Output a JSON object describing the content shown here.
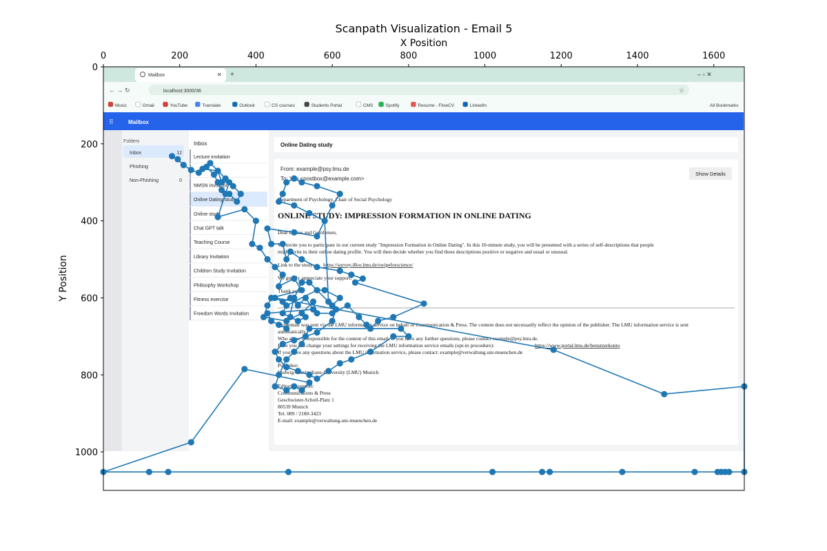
{
  "chart_data": {
    "type": "scatter",
    "title": "Scanpath Visualization - Email 5",
    "xlabel": "X Position",
    "ylabel": "Y Position",
    "xlim": [
      0,
      1680
    ],
    "ylim": [
      1100,
      0
    ],
    "x_axis_position": "top",
    "y_inverted": true,
    "x_ticks": [
      0,
      200,
      400,
      600,
      800,
      1000,
      1200,
      1400,
      1600
    ],
    "y_ticks": [
      0,
      200,
      400,
      600,
      800,
      1000
    ],
    "grid": false,
    "series_color": "#1f77b4",
    "points": [
      [
        180,
        232
      ],
      [
        195,
        240
      ],
      [
        210,
        255
      ],
      [
        230,
        268
      ],
      [
        250,
        275
      ],
      [
        270,
        260
      ],
      [
        290,
        280
      ],
      [
        300,
        300
      ],
      [
        310,
        320
      ],
      [
        330,
        330
      ],
      [
        350,
        350
      ],
      [
        360,
        330
      ],
      [
        340,
        310
      ],
      [
        320,
        290
      ],
      [
        280,
        250
      ],
      [
        260,
        265
      ],
      [
        300,
        270
      ],
      [
        310,
        300
      ],
      [
        330,
        300
      ],
      [
        320,
        330
      ],
      [
        300,
        390
      ],
      [
        370,
        370
      ],
      [
        400,
        400
      ],
      [
        390,
        460
      ],
      [
        410,
        470
      ],
      [
        430,
        500
      ],
      [
        450,
        520
      ],
      [
        470,
        540
      ],
      [
        460,
        570
      ],
      [
        500,
        550
      ],
      [
        520,
        580
      ],
      [
        440,
        600
      ],
      [
        430,
        620
      ],
      [
        420,
        650
      ],
      [
        480,
        660
      ],
      [
        520,
        640
      ],
      [
        550,
        610
      ],
      [
        560,
        640
      ],
      [
        600,
        640
      ],
      [
        640,
        620
      ],
      [
        670,
        650
      ],
      [
        690,
        670
      ],
      [
        700,
        680
      ],
      [
        720,
        660
      ],
      [
        760,
        650
      ],
      [
        840,
        615
      ],
      [
        660,
        560
      ],
      [
        680,
        550
      ],
      [
        650,
        540
      ],
      [
        620,
        530
      ],
      [
        560,
        520
      ],
      [
        520,
        500
      ],
      [
        490,
        480
      ],
      [
        480,
        500
      ],
      [
        470,
        460
      ],
      [
        440,
        460
      ],
      [
        430,
        420
      ],
      [
        500,
        430
      ],
      [
        560,
        440
      ],
      [
        600,
        360
      ],
      [
        620,
        330
      ],
      [
        560,
        310
      ],
      [
        520,
        300
      ],
      [
        500,
        290
      ],
      [
        480,
        300
      ],
      [
        470,
        330
      ],
      [
        460,
        350
      ],
      [
        500,
        360
      ],
      [
        540,
        380
      ],
      [
        580,
        400
      ],
      [
        590,
        610
      ],
      [
        610,
        630
      ],
      [
        600,
        660
      ],
      [
        560,
        690
      ],
      [
        530,
        700
      ],
      [
        500,
        710
      ],
      [
        470,
        720
      ],
      [
        450,
        740
      ],
      [
        460,
        760
      ],
      [
        480,
        780
      ],
      [
        510,
        790
      ],
      [
        540,
        800
      ],
      [
        560,
        810
      ],
      [
        590,
        790
      ],
      [
        620,
        770
      ],
      [
        650,
        760
      ],
      [
        700,
        740
      ],
      [
        760,
        700
      ],
      [
        800,
        700
      ],
      [
        780,
        680
      ],
      [
        540,
        680
      ],
      [
        520,
        720
      ],
      [
        500,
        740
      ],
      [
        480,
        760
      ],
      [
        460,
        800
      ],
      [
        450,
        830
      ],
      [
        480,
        840
      ],
      [
        500,
        830
      ],
      [
        520,
        840
      ],
      [
        540,
        820
      ],
      [
        370,
        785
      ],
      [
        230,
        975
      ],
      [
        0,
        1052
      ],
      [
        120,
        1052
      ],
      [
        170,
        1052
      ],
      [
        485,
        1052
      ],
      [
        1020,
        1052
      ],
      [
        1150,
        1052
      ],
      [
        1170,
        1052
      ],
      [
        1360,
        1052
      ],
      [
        1550,
        1052
      ],
      [
        1610,
        1052
      ],
      [
        1620,
        1052
      ],
      [
        1630,
        1052
      ],
      [
        1640,
        1052
      ],
      [
        1680,
        1052
      ],
      [
        1680,
        830
      ],
      [
        1470,
        850
      ],
      [
        1180,
        735
      ],
      [
        450,
        600
      ],
      [
        470,
        610
      ],
      [
        490,
        600
      ],
      [
        510,
        620
      ],
      [
        530,
        600
      ],
      [
        550,
        630
      ],
      [
        430,
        640
      ],
      [
        440,
        660
      ],
      [
        460,
        670
      ],
      [
        480,
        680
      ],
      [
        500,
        600
      ],
      [
        520,
        560
      ],
      [
        540,
        560
      ],
      [
        600,
        620
      ],
      [
        620,
        600
      ],
      [
        580,
        580
      ],
      [
        560,
        580
      ],
      [
        480,
        620
      ],
      [
        470,
        640
      ],
      [
        490,
        650
      ],
      [
        510,
        660
      ],
      [
        530,
        650
      ]
    ]
  },
  "background_screenshot": {
    "tab_label": "Mailbox",
    "url": "localhost:3000/36",
    "bookmarks": [
      "Music",
      "Gmail",
      "YouTube",
      "Translate",
      "Outlook",
      "CS courses",
      "Students Portal",
      "CMS",
      "Spotify",
      "Resume - FlowCV",
      "LinkedIn"
    ],
    "all_bookmarks": "All Bookmarks",
    "app_title": "Mailbox",
    "folders_heading": "Folders",
    "folders": [
      {
        "name": "Inbox",
        "count": "12"
      },
      {
        "name": "Phishing",
        "count": ""
      },
      {
        "name": "Non-Phishing",
        "count": "0"
      }
    ],
    "inbox_heading": "Inbox",
    "inbox_items": [
      "Lecture invitation",
      "",
      "NMSN Invitation",
      "Online Dating study",
      "Online study",
      "Chat GPT talk",
      "Teaching Course",
      "Library Invitation",
      "Children Study Invitation",
      "Philisophy Workshop",
      "Fitness exercise",
      "Freedom Words Invitation"
    ],
    "email_subject": "Online Dating study",
    "from": "From: example@psy.lmu.de",
    "to": "To: You <postbox@example.com>",
    "show_details": "Show Details",
    "dept": "Department of Psychology, Chair of Social Psychology",
    "headline": "ONLINE STUDY: IMPRESSION FORMATION IN ONLINE DATING",
    "greeting": "Dear Ladies and Gentlemen,",
    "body1": "We invite you to participate in our current study \"Impression Formation in Online Dating\". In this 10-minute study, you will be presented with a series of self-descriptions that people",
    "body2": "might write in their online dating profile. You will then decide whether you find these descriptions positive or negative and usual or unusual.",
    "link_label": "Link to the study:",
    "link": "https://survey.ifkw.lmu.de/swipeforscience/",
    "thanks": "We greatly appreciate your support!",
    "thanks2": "Thank you",
    "footer1": "This email was sent via the LMU information service on behalf of Communication & Press. The content does not necessarily reflect the opinion of the publisher. The LMU information service is sent",
    "footer2": "automatically.",
    "footer3": "Who alone is responsible for the content of this email. If you have any further questions, please contact example@psy.lmu.de.",
    "footer4": "Here you can change your settings for receiving the LMU information service emails (opt-in procedure):",
    "footer4_link": "https://www.portal.lmu.de/benutzerkonto",
    "footer5": "If you have any questions about the LMU information service, please contact: example@verwaltung.uni-muenchen.de",
    "publisher_label": "Publisher:",
    "publisher": "Ludwig-Maximilians-University (LMU) Munich",
    "editorial_label": "Editorial support:",
    "editorial": [
      "Communications & Press",
      "Geschwister-Scholl-Platz 1",
      "80539 Munich",
      "Tel. 089 / 2180-3423",
      "E-mail: example@verwaltung.uni-muenchen.de"
    ]
  }
}
